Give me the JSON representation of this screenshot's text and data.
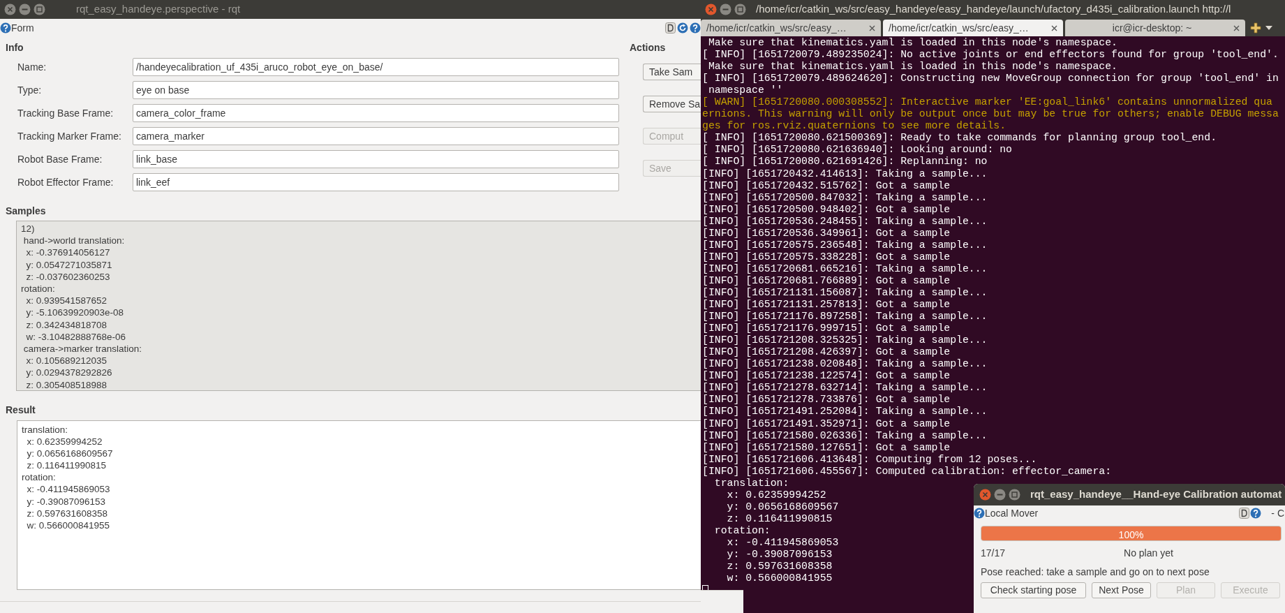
{
  "rqt_window": {
    "title": "rqt_easy_handeye.perspective - rqt",
    "plugin_title": "Form",
    "info_heading": "Info",
    "fields": [
      {
        "label": "Name:",
        "value": "/handeyecalibration_uf_435i_aruco_robot_eye_on_base/"
      },
      {
        "label": "Type:",
        "value": "eye on base"
      },
      {
        "label": "Tracking Base Frame:",
        "value": "camera_color_frame"
      },
      {
        "label": "Tracking Marker Frame:",
        "value": "camera_marker"
      },
      {
        "label": "Robot Base Frame:",
        "value": "link_base"
      },
      {
        "label": "Robot Effector Frame:",
        "value": "link_eef"
      }
    ],
    "actions_heading": "Actions",
    "action_buttons": [
      {
        "label": "Take Sam",
        "disabled": false
      },
      {
        "label": "Remove Sa",
        "disabled": false
      },
      {
        "label": "Comput",
        "disabled": true
      },
      {
        "label": "Save",
        "disabled": true
      }
    ],
    "samples_heading": "Samples",
    "samples_lines": [
      "12)",
      " hand->world translation:",
      "  x: -0.376914056127",
      "  y: 0.0547271035871",
      "  z: -0.037602360253",
      "rotation:",
      "  x: 0.939541587652",
      "  y: -5.10639920903e-08",
      "  z: 0.342434818708",
      "  w: -3.10482888768e-06",
      " camera->marker translation:",
      "  x: 0.105689212035",
      "  y: 0.0294378292826",
      "  z: 0.305408518988"
    ],
    "result_heading": "Result",
    "result_lines": [
      "translation:",
      "  x: 0.62359994252",
      "  y: 0.0656168609567",
      "  z: 0.116411990815",
      "rotation:",
      "  x: -0.411945869053",
      "  y: -0.39087096153",
      "  z: 0.597631608358",
      "  w: 0.566000841955"
    ]
  },
  "terminal": {
    "title": "/home/icr/catkin_ws/src/easy_handeye/easy_handeye/launch/ufactory_d435i_calibration.launch http://l",
    "tabs": [
      {
        "label": "/home/icr/catkin_ws/src/easy_…",
        "selected": false
      },
      {
        "label": "/home/icr/catkin_ws/src/easy_…",
        "selected": true
      },
      {
        "label": "icr@icr-desktop: ~",
        "selected": false
      }
    ],
    "lines": [
      {
        "kind": "info",
        "text": " Make sure that kinematics.yaml is loaded in this node's namespace."
      },
      {
        "kind": "info",
        "text": "[ INFO] [1651720079.489235024]: No active joints or end effectors found for group 'tool_end'."
      },
      {
        "kind": "info",
        "text": " Make sure that kinematics.yaml is loaded in this node's namespace."
      },
      {
        "kind": "info",
        "text": "[ INFO] [1651720079.489624620]: Constructing new MoveGroup connection for group 'tool_end' in"
      },
      {
        "kind": "info",
        "text": " namespace ''"
      },
      {
        "kind": "warn",
        "text": "[ WARN] [1651720080.000308552]: Interactive marker 'EE:goal_link6' contains unnormalized qua"
      },
      {
        "kind": "warn",
        "text": "ernions. This warning will only be output once but may be true for others; enable DEBUG messa"
      },
      {
        "kind": "warn",
        "text": "ges for ros.rviz.quaternions to see more details."
      },
      {
        "kind": "info",
        "text": "[ INFO] [1651720080.621500369]: Ready to take commands for planning group tool_end."
      },
      {
        "kind": "info",
        "text": "[ INFO] [1651720080.621636940]: Looking around: no"
      },
      {
        "kind": "info",
        "text": "[ INFO] [1651720080.621691426]: Replanning: no"
      },
      {
        "kind": "info",
        "text": "[INFO] [1651720432.414613]: Taking a sample..."
      },
      {
        "kind": "info",
        "text": "[INFO] [1651720432.515762]: Got a sample"
      },
      {
        "kind": "info",
        "text": "[INFO] [1651720500.847032]: Taking a sample..."
      },
      {
        "kind": "info",
        "text": "[INFO] [1651720500.948402]: Got a sample"
      },
      {
        "kind": "info",
        "text": "[INFO] [1651720536.248455]: Taking a sample..."
      },
      {
        "kind": "info",
        "text": "[INFO] [1651720536.349961]: Got a sample"
      },
      {
        "kind": "info",
        "text": "[INFO] [1651720575.236548]: Taking a sample..."
      },
      {
        "kind": "info",
        "text": "[INFO] [1651720575.338228]: Got a sample"
      },
      {
        "kind": "info",
        "text": "[INFO] [1651720681.665216]: Taking a sample..."
      },
      {
        "kind": "info",
        "text": "[INFO] [1651720681.766889]: Got a sample"
      },
      {
        "kind": "info",
        "text": "[INFO] [1651721131.156087]: Taking a sample..."
      },
      {
        "kind": "info",
        "text": "[INFO] [1651721131.257813]: Got a sample"
      },
      {
        "kind": "info",
        "text": "[INFO] [1651721176.897258]: Taking a sample..."
      },
      {
        "kind": "info",
        "text": "[INFO] [1651721176.999715]: Got a sample"
      },
      {
        "kind": "info",
        "text": "[INFO] [1651721208.325325]: Taking a sample..."
      },
      {
        "kind": "info",
        "text": "[INFO] [1651721208.426397]: Got a sample"
      },
      {
        "kind": "info",
        "text": "[INFO] [1651721238.020848]: Taking a sample..."
      },
      {
        "kind": "info",
        "text": "[INFO] [1651721238.122574]: Got a sample"
      },
      {
        "kind": "info",
        "text": "[INFO] [1651721278.632714]: Taking a sample..."
      },
      {
        "kind": "info",
        "text": "[INFO] [1651721278.733876]: Got a sample"
      },
      {
        "kind": "info",
        "text": "[INFO] [1651721491.252084]: Taking a sample..."
      },
      {
        "kind": "info",
        "text": "[INFO] [1651721491.352971]: Got a sample"
      },
      {
        "kind": "info",
        "text": "[INFO] [1651721580.026336]: Taking a sample..."
      },
      {
        "kind": "info",
        "text": "[INFO] [1651721580.127651]: Got a sample"
      },
      {
        "kind": "info",
        "text": "[INFO] [1651721606.413648]: Computing from 12 poses..."
      },
      {
        "kind": "info",
        "text": "[INFO] [1651721606.455567]: Computed calibration: effector_camera:"
      },
      {
        "kind": "info",
        "text": "  translation:"
      },
      {
        "kind": "info",
        "text": "    x: 0.62359994252"
      },
      {
        "kind": "info",
        "text": "    y: 0.0656168609567"
      },
      {
        "kind": "info",
        "text": "    z: 0.116411990815"
      },
      {
        "kind": "info",
        "text": "  rotation:"
      },
      {
        "kind": "info",
        "text": "    x: -0.411945869053"
      },
      {
        "kind": "info",
        "text": "    y: -0.39087096153"
      },
      {
        "kind": "info",
        "text": "    z: 0.597631608358"
      },
      {
        "kind": "info",
        "text": "    w: 0.566000841955"
      }
    ]
  },
  "mover_window": {
    "title": "rqt_easy_handeye__Hand-eye Calibration automat",
    "plugin_title": "Local Mover",
    "corner_text": "- C",
    "progress": {
      "level": 1,
      "text": "100%"
    },
    "counter": "17/17",
    "plan_status": "No plan yet",
    "message": "Pose reached: take a sample and go on to next pose",
    "buttons": [
      {
        "label": "Check starting pose",
        "disabled": false
      },
      {
        "label": "Next Pose",
        "disabled": false
      },
      {
        "label": "Plan",
        "disabled": true
      },
      {
        "label": "Execute",
        "disabled": true
      }
    ]
  }
}
